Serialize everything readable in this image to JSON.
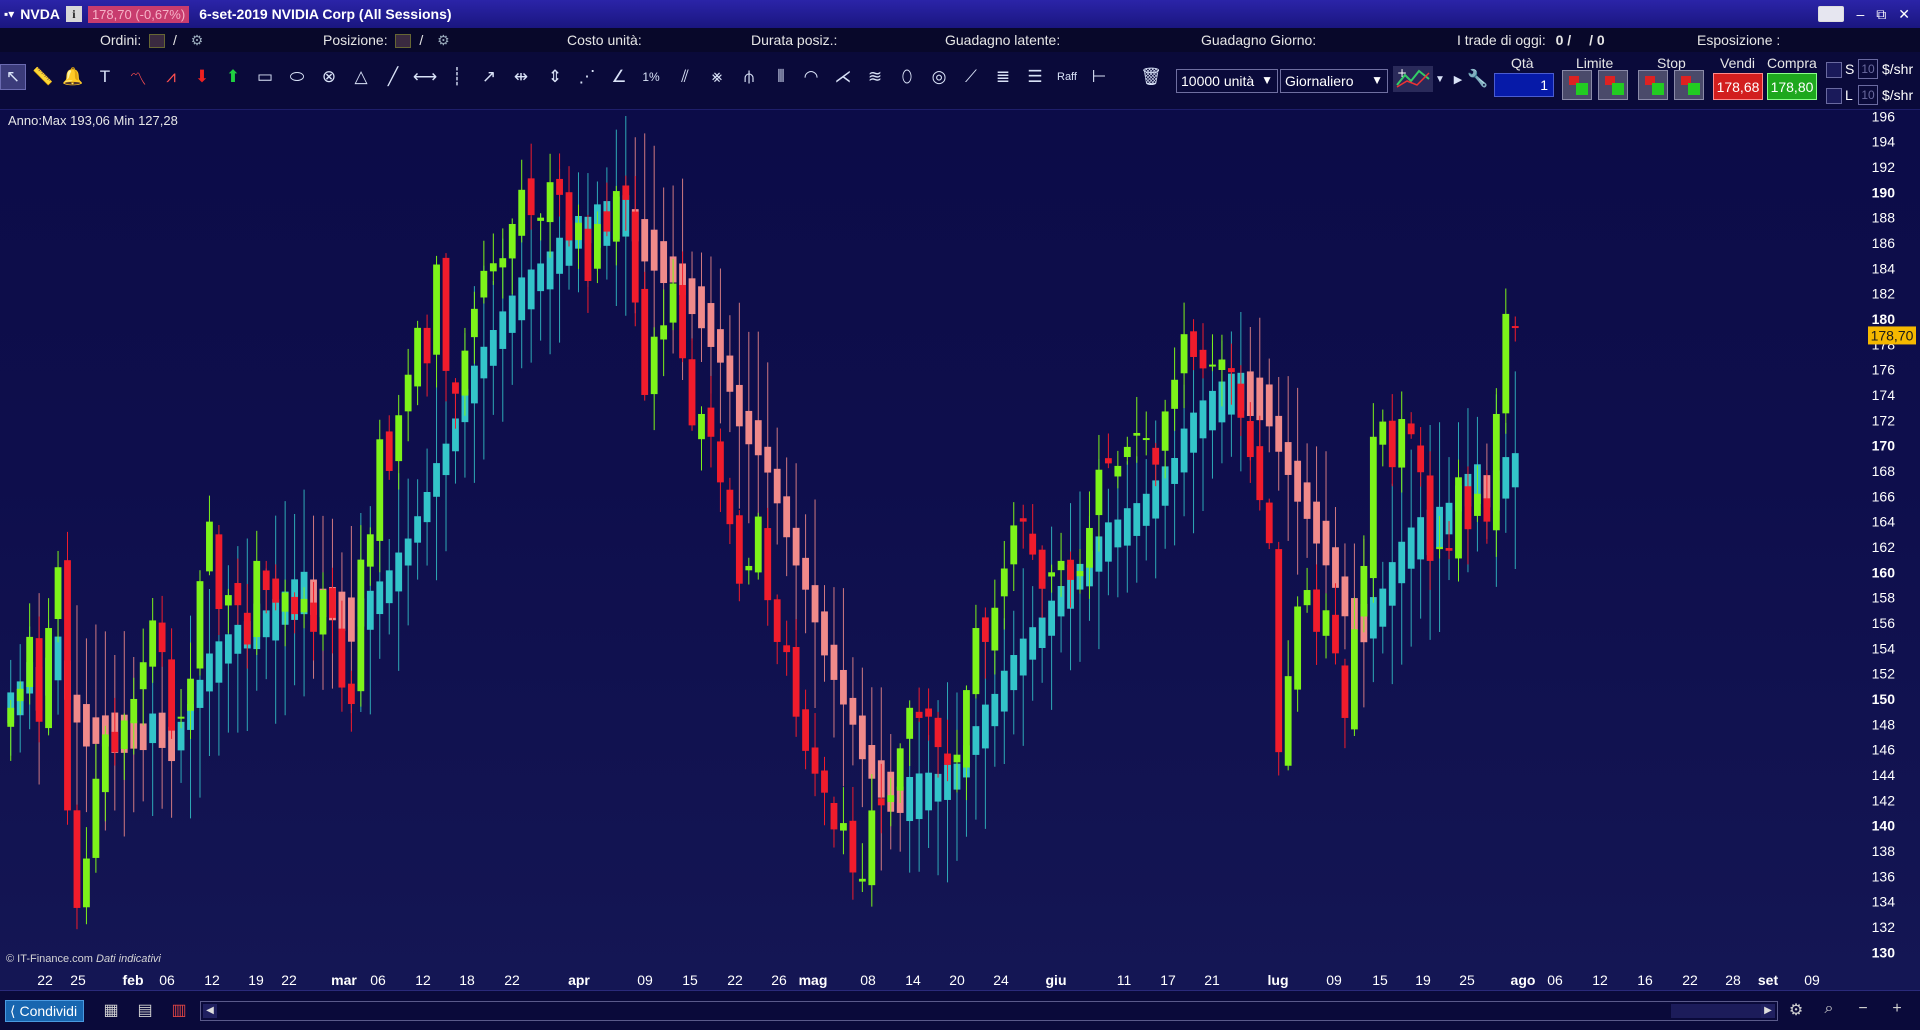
{
  "titlebar": {
    "ticker": "NVDA",
    "info_label": "i",
    "price_badge": "178,70 (-0,67%)",
    "title": "6-set-2019 NVIDIA Corp (All Sessions)",
    "minimize": "–",
    "restore": "⧉",
    "close": "✕"
  },
  "positions": {
    "ordini_label": "Ordini:",
    "ordini_sep": "/",
    "posizione_label": "Posizione:",
    "posizione_sep": "/",
    "costo_label": "Costo unità:",
    "durata_label": "Durata posiz.:",
    "guadagno_latente_label": "Guadagno latente:",
    "guadagno_giorno_label": "Guadagno Giorno:",
    "trade_oggi_label": "I trade di oggi:",
    "trade_oggi_a": "0 /",
    "trade_oggi_b": "/ 0",
    "esposizione_label": "Esposizione :"
  },
  "toolbar": {
    "quantity_dropdown": "10000 unità",
    "period_dropdown": "Giornaliero",
    "qta_label": "Qtà",
    "limite_label": "Limite",
    "stop_label": "Stop",
    "vendi_label": "Vendi",
    "compra_label": "Compra",
    "qty_value": "1",
    "sell_price": "178,68",
    "buy_price": "178,80",
    "s_label": "S",
    "l_label": "L",
    "s_num": "10",
    "l_num": "10",
    "unit_s": "$/shr",
    "unit_l": "$/shr",
    "tool_icons": [
      "cursor-icon",
      "ruler-icon",
      "alarm-bell-icon",
      "text-icon",
      "trendline-icon",
      "zigzag-icon",
      "sell-arrow-icon",
      "buy-arrow-icon",
      "rectangle-icon",
      "ellipse-icon",
      "circle-icon",
      "triangle-icon",
      "line-icon",
      "horizontal-line-icon",
      "vertical-line-icon",
      "ray-icon",
      "cross-line-icon",
      "measure-icon",
      "fan-icon",
      "angle-icon",
      "percent-icon",
      "channel-icon",
      "regression-icon",
      "pitchfork-icon",
      "cycle-lines-icon",
      "arc-icon",
      "gann-fan-icon",
      "parallel-lines-icon",
      "ellipse-tool-icon",
      "spiral-icon",
      "speed-lines-icon",
      "fibonacci-icon",
      "retracement-icon",
      "raff-channel-icon",
      "extension-icon",
      "trash-icon"
    ],
    "raff_label": "Raff",
    "percent_label": "1%"
  },
  "chart": {
    "range_label": "Anno:Max 193,06 Min 127,28",
    "source": "© IT-Finance.com",
    "source_note": "Dati indicativi",
    "last_price_label": "178,70",
    "colors": {
      "up": "#7df31a",
      "down": "#f01c2c",
      "ma_up": "#33c4c9",
      "ma_down": "#f08a8a",
      "axis_text": "#ffffff",
      "last_price_bg": "#f5b800"
    }
  },
  "chart_data": {
    "type": "candlestick",
    "title": "",
    "xlabel": "",
    "ylabel": "",
    "ylim": [
      128.6,
      196.5
    ],
    "y_ticks": [
      196,
      194,
      192,
      190,
      188,
      186,
      184,
      182,
      180,
      178,
      176,
      174,
      172,
      170,
      168,
      166,
      164,
      162,
      160,
      158,
      156,
      154,
      152,
      150,
      148,
      146,
      144,
      142,
      140,
      138,
      136,
      134,
      132,
      130
    ],
    "y_bold_ticks": [
      190,
      180,
      170,
      160,
      150,
      140,
      130
    ],
    "x_ticks": [
      "22",
      "25",
      "feb",
      "06",
      "12",
      "19",
      "22",
      "mar",
      "06",
      "12",
      "18",
      "22",
      "apr",
      "09",
      "15",
      "22",
      "26",
      "mag",
      "08",
      "14",
      "20",
      "24",
      "giu",
      "11",
      "17",
      "21",
      "lug",
      "09",
      "15",
      "19",
      "25",
      "ago",
      "06",
      "12",
      "16",
      "22",
      "28",
      "set",
      "09"
    ],
    "x_bold_ticks": [
      "feb",
      "mar",
      "apr",
      "mag",
      "giu",
      "lug",
      "ago",
      "set"
    ],
    "last_price": 178.7,
    "series": [
      {
        "name": "",
        "kind": "candles",
        "close": [
          149.3,
          150.8,
          154.9,
          148.2,
          155.6,
          160.4,
          141.2,
          133.5,
          137.4,
          143.7,
          147.2,
          145.8,
          148.3,
          150.0,
          152.9,
          156.2,
          153.7,
          147.5,
          148.6,
          151.6,
          159.3,
          164.0,
          157.1,
          158.2,
          157.4,
          154.3,
          160.9,
          158.6,
          157.6,
          158.4,
          156.7,
          157.9,
          155.3,
          158.6,
          156.4,
          150.9,
          149.6,
          161.0,
          163.0,
          170.5,
          168.0,
          172.4,
          175.6,
          179.3,
          176.5,
          184.3,
          175.9,
          174.1,
          177.5,
          180.8,
          183.8,
          184.4,
          184.8,
          187.5,
          190.2,
          188.2,
          188.0,
          190.8,
          189.8,
          186.2,
          187.6,
          183.0,
          187.5,
          186.9,
          190.1,
          189.4,
          181.3,
          174.0,
          178.6,
          179.5,
          182.8,
          176.9,
          171.6,
          172.5,
          170.7,
          167.1,
          163.8,
          159.1,
          160.5,
          164.4,
          157.8,
          154.5,
          153.7,
          148.6,
          145.9,
          144.1,
          142.6,
          139.7,
          140.2,
          136.3,
          135.8,
          141.2,
          141.6,
          142.4,
          146.1,
          149.3,
          148.5,
          148.6,
          146.2,
          144.8,
          145.6,
          150.7,
          155.6,
          154.5,
          157.2,
          160.3,
          163.7,
          164.0,
          161.4,
          158.7,
          160.0,
          160.9,
          159.4,
          160.1,
          163.5,
          168.1,
          168.6,
          168.4,
          169.9,
          171.0,
          170.6,
          168.5,
          172.7,
          175.2,
          178.8,
          177.0,
          176.1,
          176.4,
          176.8,
          175.8,
          172.2,
          169.1,
          165.7,
          162.3,
          145.8,
          151.8,
          157.3,
          158.6,
          155.3,
          157.0,
          153.6,
          148.5,
          155.5,
          160.5,
          170.7,
          171.9,
          168.3,
          172.1,
          170.9,
          167.9,
          160.9,
          162.0,
          161.7,
          167.5,
          163.4,
          166.2,
          164.0,
          172.5,
          180.4,
          179.3
        ]
      },
      {
        "name": "",
        "kind": "moving-average-bars"
      }
    ]
  },
  "statusbar": {
    "share_label": "Condividi",
    "icons": [
      "layout-icon",
      "document-icon",
      "table-icon",
      "chart-settings-icon",
      "zoom-fit-icon",
      "zoom-out-icon",
      "zoom-in-icon"
    ]
  }
}
